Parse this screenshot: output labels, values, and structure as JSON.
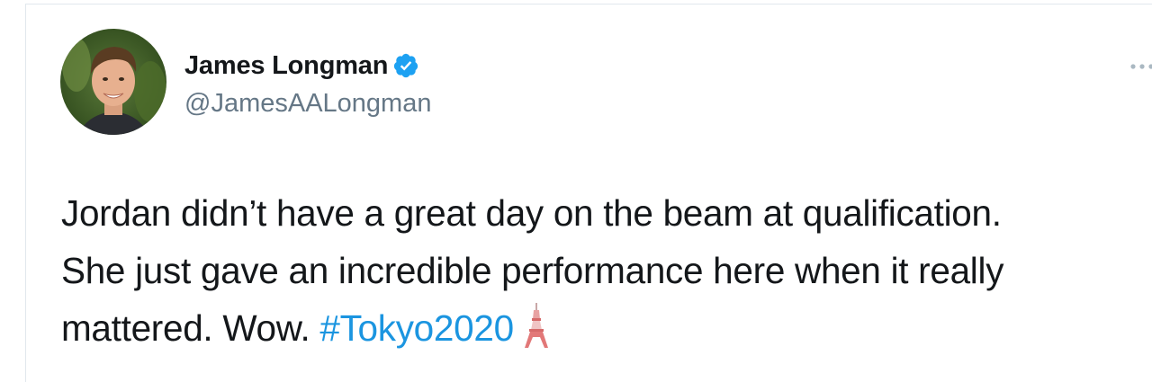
{
  "tweet": {
    "author": {
      "display_name": "James Longman",
      "handle": "@JamesAALongman",
      "verified": true,
      "verified_icon": "verified-badge-icon",
      "avatar_icon": "profile-photo"
    },
    "text_lines": [
      "Jordan didn’t have a great day on the beam at qualification.",
      "She just gave an incredible performance here when it really",
      "mattered. Wow."
    ],
    "hashtag": "#Tokyo2020",
    "emoji_icon": "tokyo-tower-icon",
    "more_icon": "more-options-icon"
  },
  "colors": {
    "text": "#14171a",
    "secondary_text": "#657786",
    "link": "#1b95e0",
    "verified": "#1da1f2",
    "border": "#e1e8ed",
    "more_dots": "#aab8c2"
  }
}
